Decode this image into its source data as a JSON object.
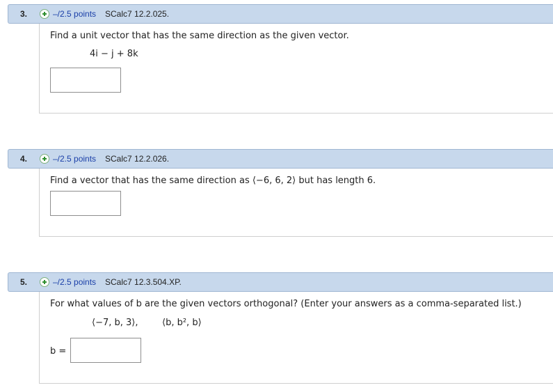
{
  "questions": [
    {
      "number": "3.",
      "points": "–/2.5 points",
      "source": "SCalc7 12.2.025.",
      "prompt": "Find a unit vector that has the same direction as the given vector.",
      "expression": "4i − j + 8k",
      "answer": ""
    },
    {
      "number": "4.",
      "points": "–/2.5 points",
      "source": "SCalc7 12.2.026.",
      "prompt": "Find a vector that has the same direction as ⟨−6, 6, 2⟩ but has length 6.",
      "answer": ""
    },
    {
      "number": "5.",
      "points": "–/2.5 points",
      "source": "SCalc7 12.3.504.XP.",
      "prompt": "For what values of b are the given vectors orthogonal? (Enter your answers as a comma-separated list.)",
      "vector1": "⟨−7, b, 3⟩,",
      "vector2": "⟨b, b², b⟩",
      "answer_label": "b =",
      "answer": ""
    }
  ],
  "colors": {
    "header_bg": "#c7d8ec",
    "header_border": "#9fb6d2",
    "points_link": "#1a3fa8",
    "plus_icon": "#2f8f2f"
  },
  "icons": {
    "expand": "plus-circle-icon"
  }
}
